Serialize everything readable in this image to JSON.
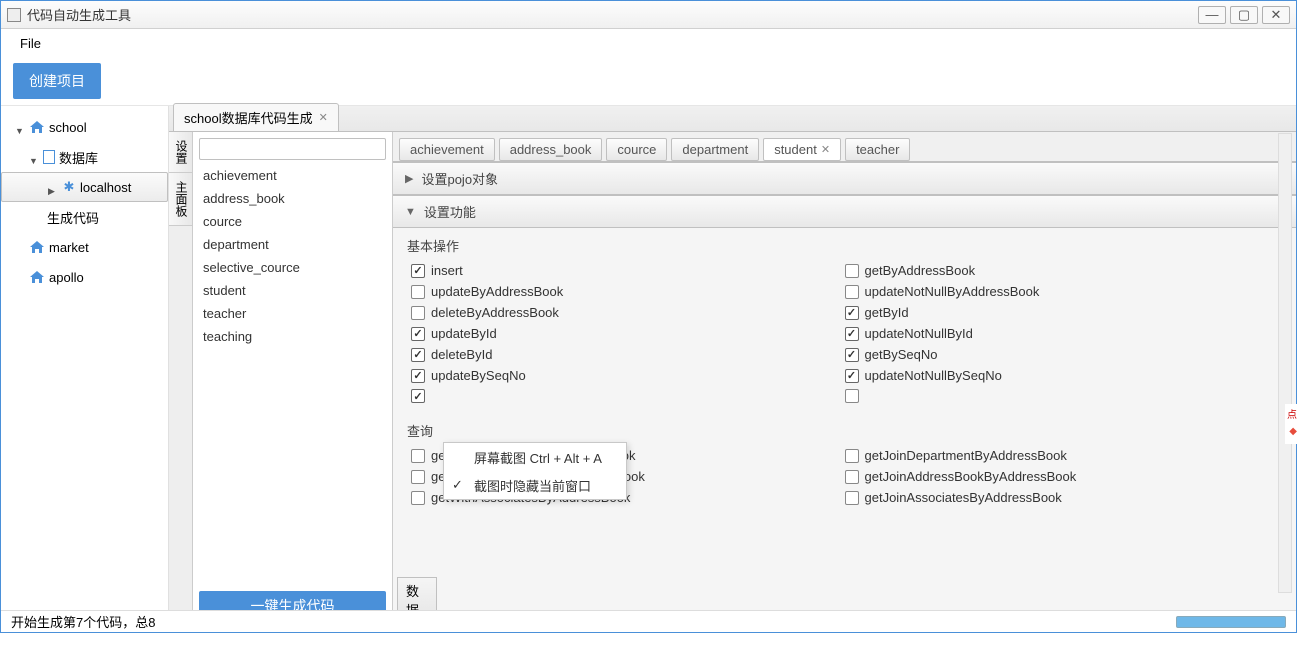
{
  "window": {
    "title": "代码自动生成工具"
  },
  "menubar": {
    "file": "File"
  },
  "toolbar": {
    "create_project": "创建项目"
  },
  "sidebar": {
    "items": [
      {
        "label": "school",
        "icon": "house",
        "expand": "down",
        "indent": 1
      },
      {
        "label": "数据库",
        "icon": "db",
        "expand": "down",
        "indent": 2
      },
      {
        "label": "localhost",
        "icon": "bt",
        "expand": "right",
        "indent": 3,
        "selected": true
      },
      {
        "label": "生成代码",
        "icon": "",
        "indent": 3
      },
      {
        "label": "market",
        "icon": "house",
        "indent": 2
      },
      {
        "label": "apollo",
        "icon": "house",
        "indent": 2
      }
    ]
  },
  "doc_tab": {
    "label": "school数据库代码生成"
  },
  "vtabs": {
    "t0": "设置",
    "t1": "主面板"
  },
  "table_list": [
    "achievement",
    "address_book",
    "cource",
    "department",
    "selective_cource",
    "student",
    "teacher",
    "teaching"
  ],
  "gen_button": "一键生成代码",
  "inner_tabs": [
    {
      "label": "achievement"
    },
    {
      "label": "address_book"
    },
    {
      "label": "cource"
    },
    {
      "label": "department"
    },
    {
      "label": "student",
      "active": true,
      "closable": true
    },
    {
      "label": "teacher"
    }
  ],
  "accordion": {
    "pojo": "设置pojo对象",
    "func": "设置功能"
  },
  "sections": {
    "basic": "基本操作",
    "query": "查询"
  },
  "ops_basic": [
    {
      "label": "insert",
      "checked": true
    },
    {
      "label": "getByAddressBook",
      "checked": false
    },
    {
      "label": "updateByAddressBook",
      "checked": false
    },
    {
      "label": "updateNotNullByAddressBook",
      "checked": false
    },
    {
      "label": "deleteByAddressBook",
      "checked": false
    },
    {
      "label": "getById",
      "checked": true
    },
    {
      "label": "updateById",
      "checked": true
    },
    {
      "label": "updateNotNullById",
      "checked": true
    },
    {
      "label": "deleteById",
      "checked": true
    },
    {
      "label": "getBySeqNo",
      "checked": true
    },
    {
      "label": "updateBySeqNo",
      "checked": true
    },
    {
      "label": "updateNotNullBySeqNo",
      "checked": true
    },
    {
      "label": "",
      "checked": true
    },
    {
      "label": "",
      "checked": false
    }
  ],
  "ops_query": [
    {
      "label": "getWithDepartmentByAddressBook",
      "checked": false
    },
    {
      "label": "getJoinDepartmentByAddressBook",
      "checked": false
    },
    {
      "label": "getWithAddressBookByAddressBook",
      "checked": false
    },
    {
      "label": "getJoinAddressBookByAddressBook",
      "checked": false
    },
    {
      "label": "getWithAssociatesByAddressBook",
      "checked": false
    },
    {
      "label": "getJoinAssociatesByAddressBook",
      "checked": false
    }
  ],
  "bottom_tab": "数据",
  "context_menu": {
    "item0": "屏幕截图 Ctrl + Alt + A",
    "item1": "截图时隐藏当前窗口"
  },
  "status": {
    "text": "开始生成第7个代码，总8"
  }
}
